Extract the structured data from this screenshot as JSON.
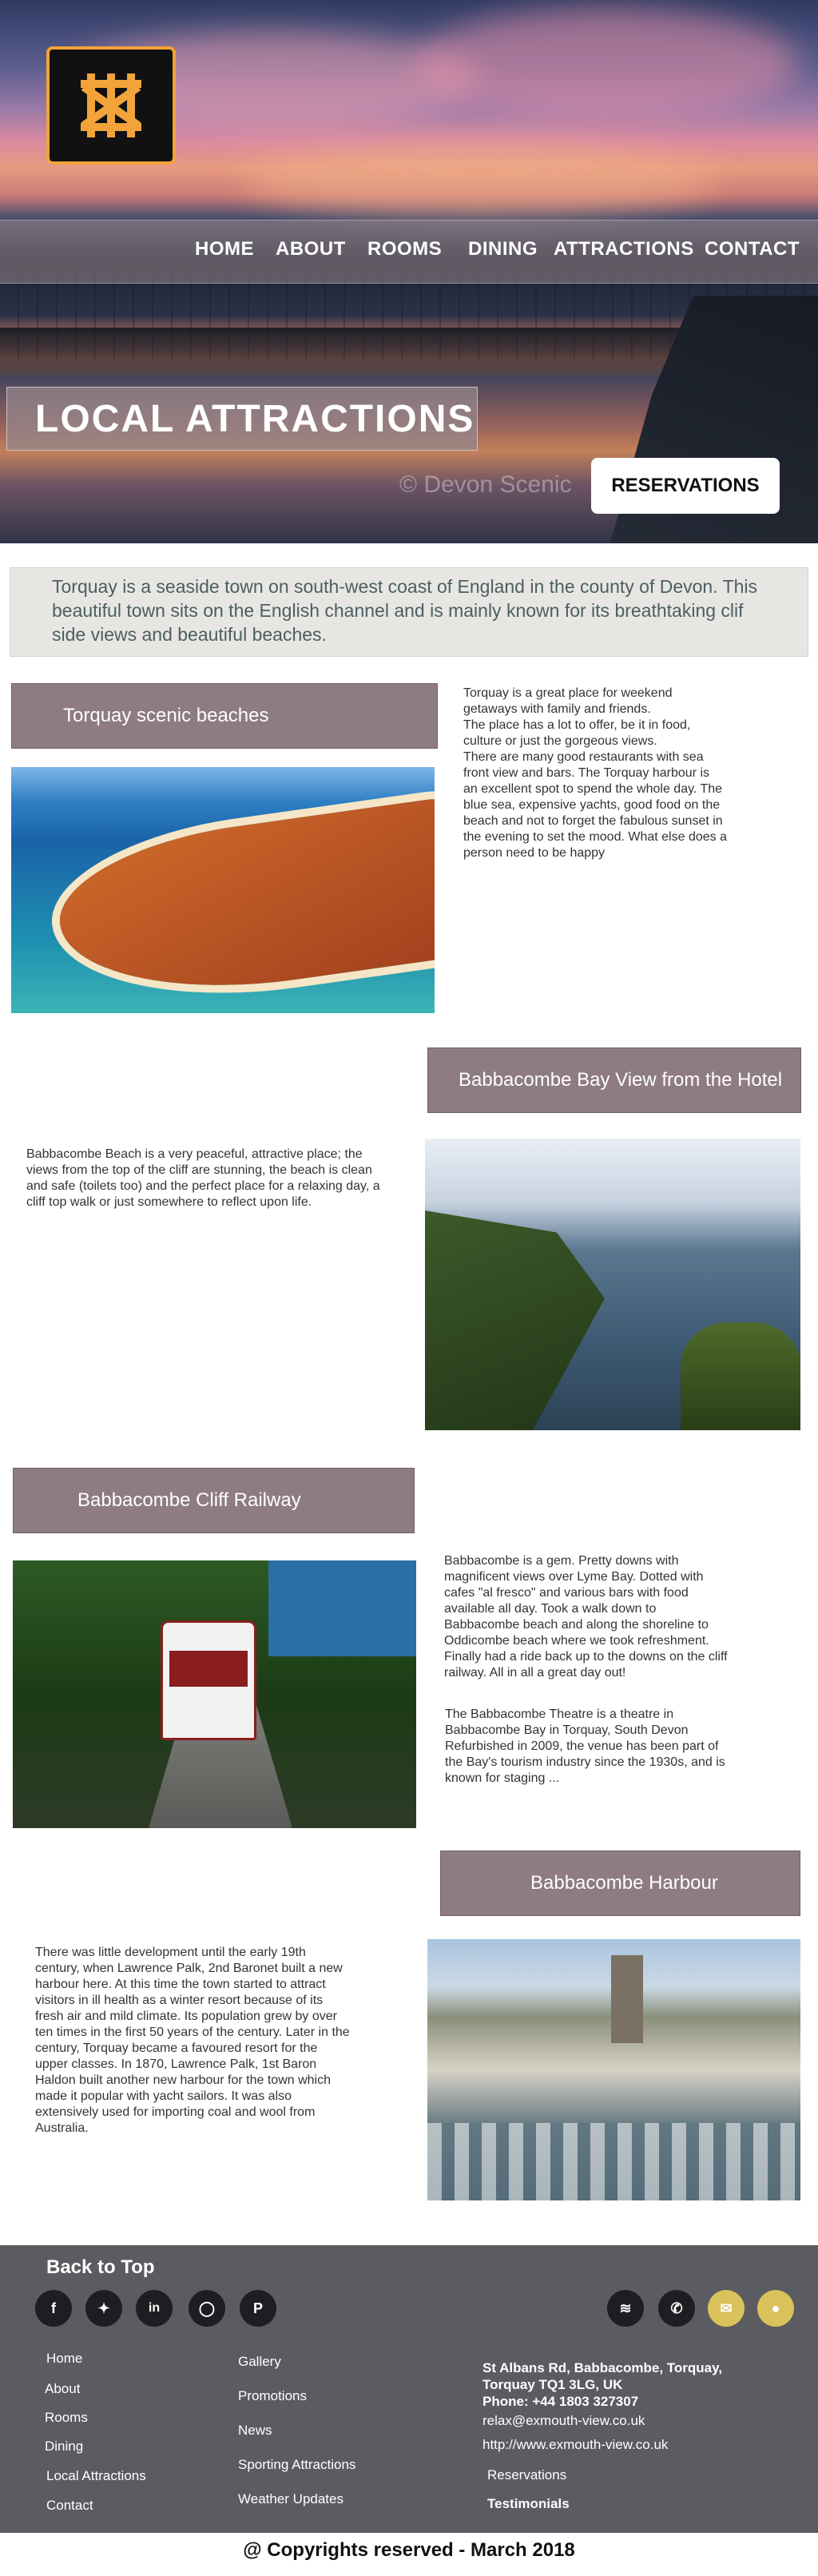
{
  "hero": {
    "watermark": "© Devon Scenic",
    "title": "LOCAL ATTRACTIONS",
    "reservations_button": "RESERVATIONS"
  },
  "nav": {
    "items": [
      "HOME",
      "ABOUT",
      "ROOMS",
      "DINING",
      "ATTRACTIONS",
      "CONTACT"
    ]
  },
  "intro": {
    "text": "Torquay is a seaside town on south-west coast of England in the county of Devon. This beautiful town sits on the English channel and is mainly known for its breathtaking clif side views and beautiful beaches."
  },
  "sections": [
    {
      "title": "Torquay scenic beaches",
      "text": "Torquay is a great place for weekend getaways with family and friends.\nThe place has a lot to offer, be it in food, culture or just the gorgeous views.\nThere are many good restaurants with sea front view and bars. The Torquay harbour is an excellent spot to spend the whole day. The blue sea, expensive  yachts, good food on the beach and not to forget the fabulous sunset in the evening to set the mood. What else does a person need to be happy"
    },
    {
      "title": "Babbacombe Bay View from the Hotel",
      "text": "Babbacombe Beach is a very peaceful, attractive place; the views from the top of the cliff are stunning, the beach is clean and safe (toilets too) and the perfect place for a relaxing day, a cliff top walk or just somewhere to reflect upon life."
    },
    {
      "title": "Babbacombe Cliff Railway",
      "text": "Babbacombe is a gem. Pretty downs with magnificent views over Lyme Bay. Dotted with cafes \"al fresco\" and various bars with food available all day. Took a walk down to Babbacombe beach and along the shoreline to Oddicombe beach where we took refreshment. Finally had a ride back up to the downs on the cliff railway. All in all a great day out!",
      "text2": "The Babbacombe Theatre is a theatre in Babbacombe Bay in Torquay, South Devon Refurbished in 2009, the venue has been part of the Bay's tourism industry since the 1930s, and is known for staging ..."
    },
    {
      "title": "Babbacombe Harbour",
      "text": "There was little development until the early 19th century, when Lawrence Palk, 2nd Baronet built a new harbour here. At this time the town started to attract visitors in ill health as a winter resort because of its fresh air and mild climate. Its population grew by over ten times in the first 50 years of the century. Later in the century, Torquay became a favoured resort for the upper classes. In 1870, Lawrence Palk, 1st Baron Haldon built another new harbour for the town which made it popular with yacht sailors. It was also extensively used for importing coal and wool from Australia."
    }
  ],
  "footer": {
    "back_to_top": "Back to Top",
    "social": [
      "f",
      "t",
      "in",
      "ig",
      "p",
      "rss",
      "wa",
      "mail",
      "pin"
    ],
    "col1": [
      "Home",
      "About",
      "Rooms",
      "Dining",
      "Local Attractions",
      "Contact"
    ],
    "col2": [
      "Gallery",
      "Promotions",
      "News",
      "Sporting Attractions",
      "Weather Updates"
    ],
    "address_line1": "St Albans Rd, Babbacombe, Torquay,",
    "address_line2": "Torquay TQ1 3LG, UK",
    "phone": "Phone: +44 1803 327307",
    "email": "relax@exmouth-view.co.uk",
    "website": "http://www.exmouth-view.co.uk",
    "reservations": "Reservations",
    "testimonials": "Testimonials"
  },
  "copyright": "@ Copyrights reserved - March 2018",
  "colors": {
    "accent": "#f2a33a",
    "title_box": "#8e7c82",
    "footer_bg": "#5b5c61"
  }
}
